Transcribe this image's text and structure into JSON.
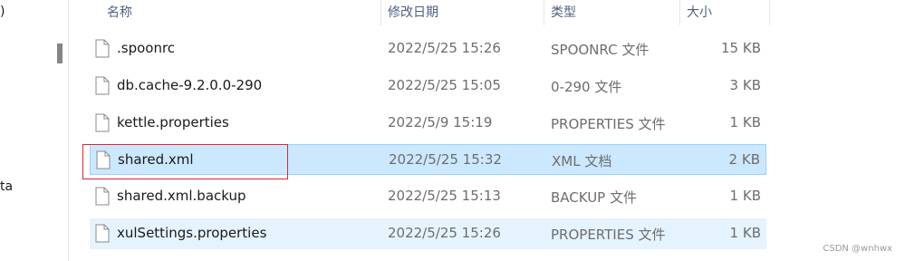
{
  "nav_pane": {
    "fragment_top": ")",
    "fragment_mid": "ta"
  },
  "header": {
    "columns": {
      "name": "名称",
      "date": "修改日期",
      "type": "类型",
      "size": "大小"
    },
    "top_clip": "^"
  },
  "files": [
    {
      "name": ".spoonrc",
      "date": "2022/5/25 15:26",
      "type": "SPOONRC 文件",
      "size": "15 KB",
      "icon": "file-icon"
    },
    {
      "name": "db.cache-9.2.0.0-290",
      "date": "2022/5/25 15:05",
      "type": "0-290 文件",
      "size": "3 KB",
      "icon": "file-icon"
    },
    {
      "name": "kettle.properties",
      "date": "2022/5/9 15:19",
      "type": "PROPERTIES 文件",
      "size": "1 KB",
      "icon": "file-icon"
    },
    {
      "name": "shared.xml",
      "date": "2022/5/25 15:32",
      "type": "XML 文档",
      "size": "2 KB",
      "icon": "file-icon",
      "state": "selected"
    },
    {
      "name": "shared.xml.backup",
      "date": "2022/5/25 15:13",
      "type": "BACKUP 文件",
      "size": "1 KB",
      "icon": "file-icon"
    },
    {
      "name": "xulSettings.properties",
      "date": "2022/5/25 15:26",
      "type": "PROPERTIES 文件",
      "size": "1 KB",
      "icon": "file-icon",
      "state": "hover"
    }
  ],
  "annotation": {
    "color": "#d6282f"
  },
  "watermark": "CSDN @wnhwx"
}
